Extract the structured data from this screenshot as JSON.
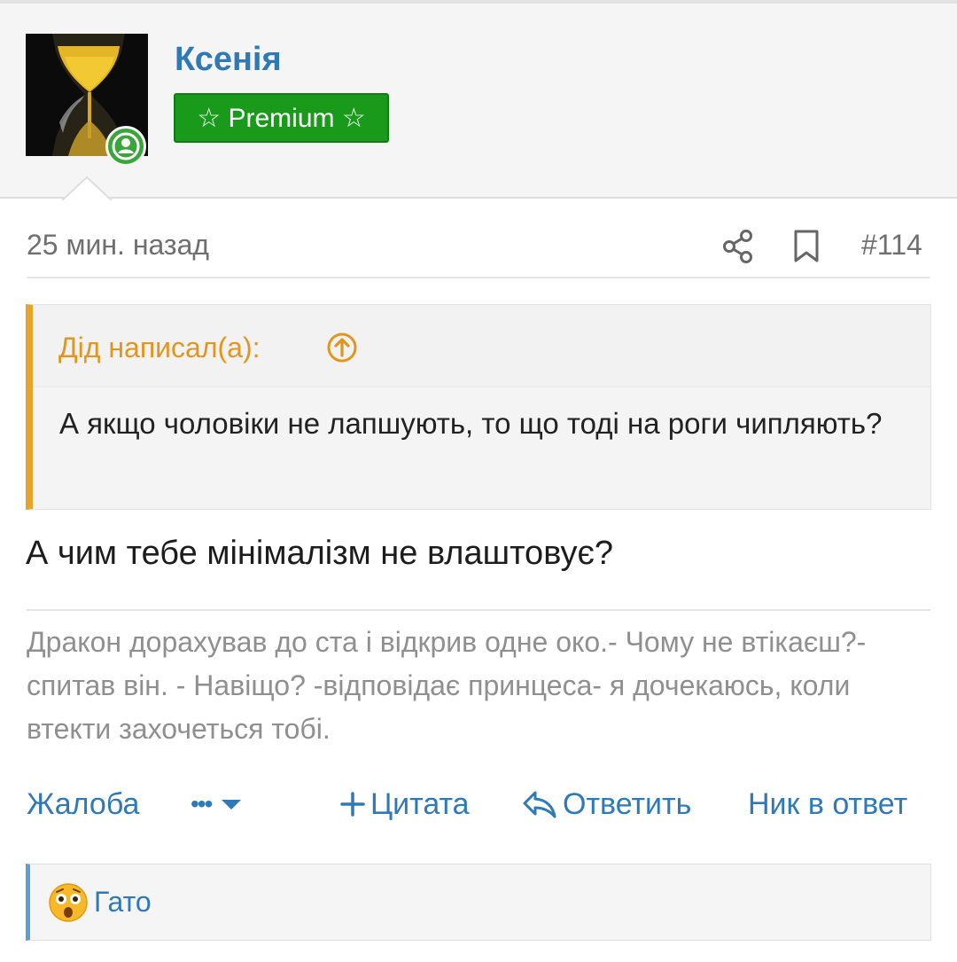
{
  "user": {
    "name": "Ксенія",
    "badge": "☆ Premium ☆"
  },
  "post": {
    "time": "25 мин. назад",
    "number": "#114",
    "quote": {
      "author": "Дід написал(а):",
      "text": "А якщо чоловіки не лапшують, то що тоді на роги чипляють?"
    },
    "body": "А чим тебе мінімалізм не влаштовує?",
    "signature": "Дракон дорахував до ста і відкрив одне око.- Чому не втікаєш?- спитав він. - Навіщо? -відповідає принцеса- я дочекаюсь, коли втекти захочеться тобі."
  },
  "actions": {
    "report": "Жалоба",
    "more": "•••",
    "quote": "Цитата",
    "reply": "Ответить",
    "nick": "Ник в ответ"
  },
  "reactions": {
    "user": "Гато",
    "emoji": "astonished-face-icon"
  },
  "colors": {
    "link": "#2f79b7",
    "premium": "#1a9a1a",
    "quote_accent": "#e8a42a",
    "online": "#3aa53a"
  }
}
